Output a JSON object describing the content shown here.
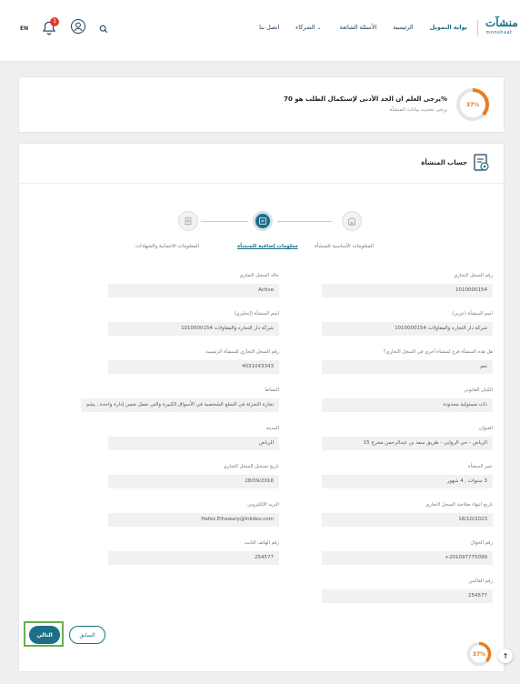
{
  "nav": {
    "logo_ar": "منشآت",
    "logo_en": "monshaat",
    "links": [
      "بوابة التمويل",
      "الرئيسية",
      "الأسئلة الشائعة",
      "الشركاء",
      "اتصل بنا"
    ],
    "language": "EN",
    "notifications_count": "1"
  },
  "notice": {
    "progress": "37%",
    "progress_value": 37,
    "title": "يرجى العلم ان الحد الأدنى لإستكمال الطلب هو 70%",
    "subtitle": "يرجى تحديث بيانات المنشأة"
  },
  "account": {
    "title": "حساب المنشأة"
  },
  "steps": [
    {
      "label": "المعلومات الأساسية للمنشأة",
      "state": "done"
    },
    {
      "label": "معلومات إضافية للمنشأة",
      "state": "active"
    },
    {
      "label": "المعلومات الائتمانية والشهادات",
      "state": "pending"
    }
  ],
  "fields_right": [
    {
      "label": "رقم السجل التجاري",
      "value": "1010000154"
    },
    {
      "label": "اسم المنشأة (عربي)",
      "value": "شركة دار التجاره والمقاولات 1010000154"
    },
    {
      "label": "هل هذه المنشأة فرع لمنشأة أخرى في السجل التجاري؟",
      "value": "نعم"
    },
    {
      "label": "الكيان القانوني",
      "value": "ذات مسئولية محدودة"
    },
    {
      "label": "العنوان",
      "value": "الرياض - حي الروابي - طريق سعد بن عبدالرحمن مخرج 15"
    },
    {
      "label": "عمر المنشأة",
      "value": "3 سنوات , 4 شهور"
    },
    {
      "label": "تاريخ انتهاء صلاحية السجل التجاري",
      "value": "18/10/2023"
    },
    {
      "label": "رقم الجوال",
      "value": "201097775099+"
    },
    {
      "label": "رقم الفاكس",
      "value": "254577"
    }
  ],
  "fields_left": [
    {
      "label": "حالة السجل التجاري",
      "value": "Active"
    },
    {
      "label": "اسم المنشأة (إنجليزي)",
      "value": "شركة دار التجاره والمقاولات 1010000154"
    },
    {
      "label": "رقم السجل التجاري للمنشأة الرئيسية",
      "value": "4031043343"
    },
    {
      "label": "النشاط",
      "value": "تجارة التجزئة في السلع الشخصية في الأسواق الكبيرة والتي تعمل ضمن إدارة واحدة , يشم"
    },
    {
      "label": "المدينة",
      "value": "الرياض"
    },
    {
      "label": "تاريخ تسجيل السجل التجاري",
      "value": "28/09/2016"
    },
    {
      "label": "البريد الإلكتروني",
      "value": "Hafez.Elhawary@Inkdev.com"
    },
    {
      "label": "رقم الهاتف الثابت",
      "value": "254577"
    }
  ],
  "buttons": {
    "next": "التالي",
    "prev": "السابق"
  },
  "bottom_progress": "37%",
  "colors": {
    "primary": "#1b6f86",
    "accent": "#e67e22",
    "highlight": "#6ab04c"
  }
}
